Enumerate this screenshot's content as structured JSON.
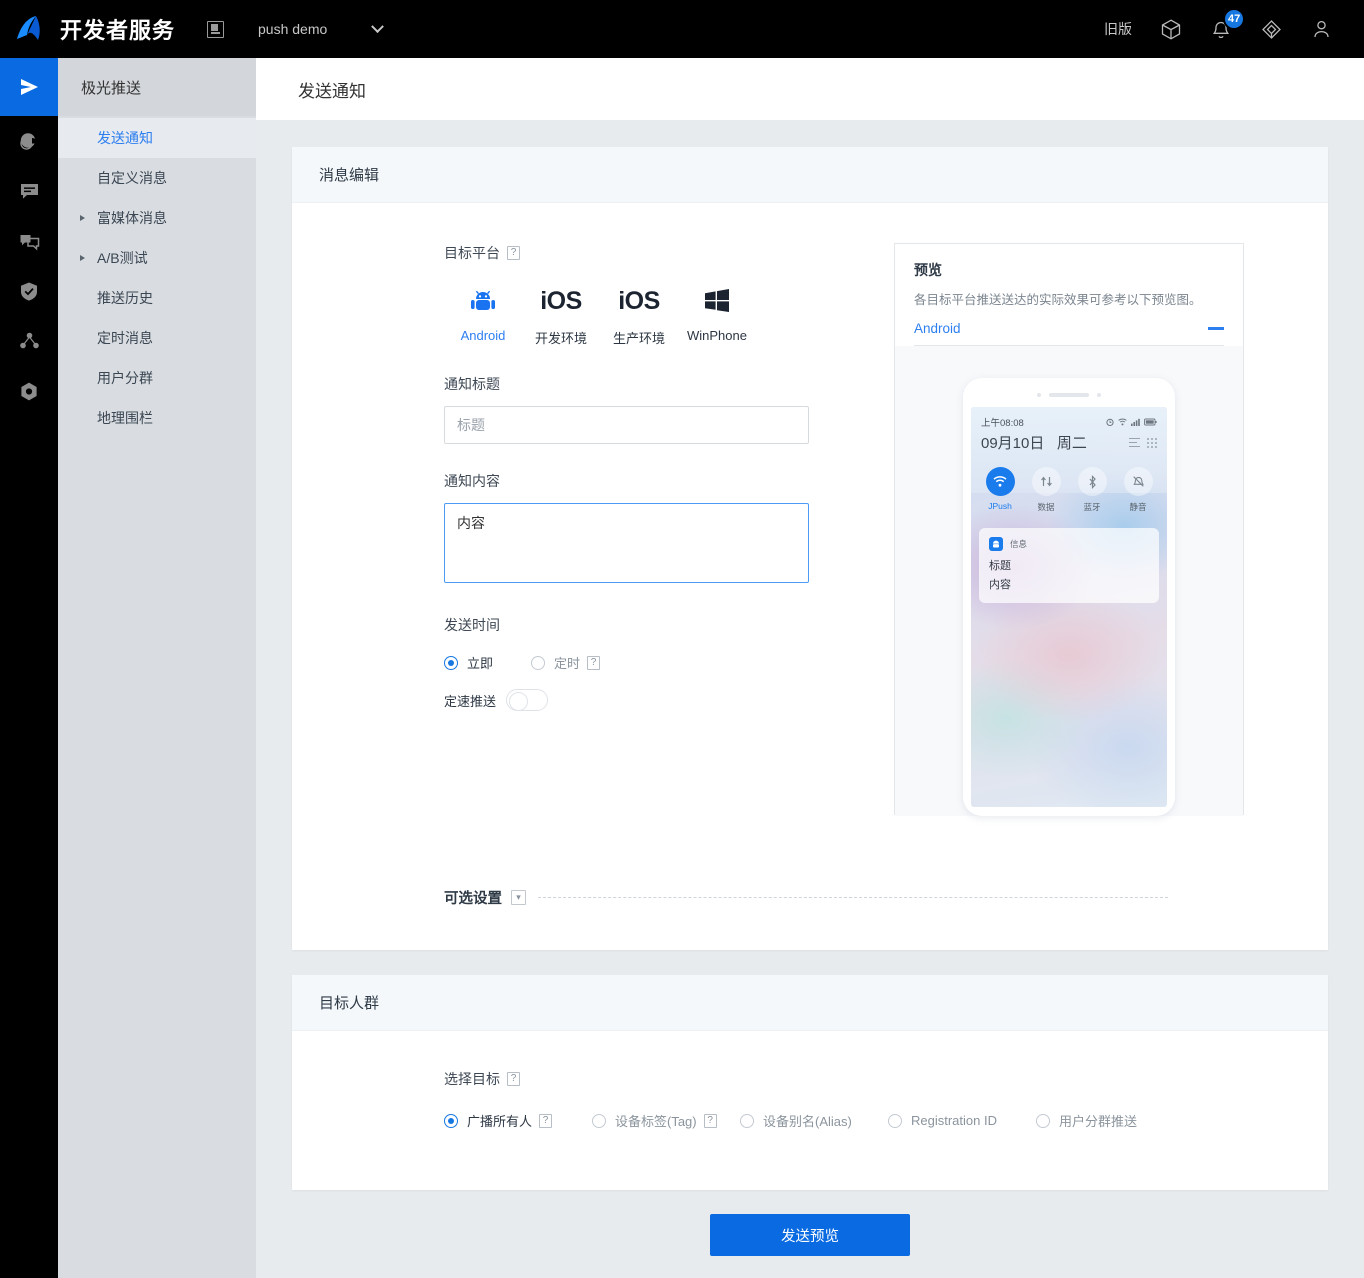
{
  "topbar": {
    "brand": "开发者服务",
    "project_icon": "window-icon",
    "project_name": "push demo",
    "caret": "chevron-down-icon",
    "legacy_label": "旧版",
    "cube_icon": "cube-icon",
    "bell_icon": "bell-icon",
    "bell_badge": "47",
    "help_icon": "lifebuoy-icon",
    "user_icon": "user-icon",
    "badge_color": "#1677e0"
  },
  "rail": {
    "items": [
      {
        "icon": "send-icon",
        "active": true
      },
      {
        "icon": "pie-chart-icon",
        "active": false
      },
      {
        "icon": "message-icon",
        "active": false
      },
      {
        "icon": "im-chat-icon",
        "active": false
      },
      {
        "icon": "shield-check-icon",
        "active": false
      },
      {
        "icon": "share-network-icon",
        "active": false
      },
      {
        "icon": "hexagon-settings-icon",
        "active": false
      }
    ]
  },
  "sidebar": {
    "title": "极光推送",
    "items": [
      {
        "label": "发送通知",
        "selected": true,
        "expandable": false
      },
      {
        "label": "自定义消息",
        "selected": false,
        "expandable": false
      },
      {
        "label": "富媒体消息",
        "selected": false,
        "expandable": true
      },
      {
        "label": "A/B测试",
        "selected": false,
        "expandable": true
      },
      {
        "label": "推送历史",
        "selected": false,
        "expandable": false
      },
      {
        "label": "定时消息",
        "selected": false,
        "expandable": false
      },
      {
        "label": "用户分群",
        "selected": false,
        "expandable": false
      },
      {
        "label": "地理围栏",
        "selected": false,
        "expandable": false
      }
    ]
  },
  "page": {
    "title": "发送通知"
  },
  "message_card": {
    "header": "消息编辑",
    "platform_label": "目标平台",
    "platform_help": "?",
    "platforms": [
      {
        "name": "Android",
        "icon": "android-icon",
        "active": true
      },
      {
        "name": "开发环境",
        "icon": "ios-icon",
        "active": false
      },
      {
        "name": "生产环境",
        "icon": "ios-icon",
        "active": false
      },
      {
        "name": "WinPhone",
        "icon": "windows-icon",
        "active": false
      }
    ],
    "title_label": "通知标题",
    "title_placeholder": "标题",
    "title_value": "",
    "content_label": "通知内容",
    "content_value": "内容",
    "content_placeholder": "内容",
    "send_time_label": "发送时间",
    "send_time_options": [
      {
        "label": "立即",
        "selected": true,
        "help": false
      },
      {
        "label": "定时",
        "selected": false,
        "help": true
      }
    ],
    "rate_label": "定速推送",
    "rate_on": false,
    "optional_label": "可选设置",
    "optional_chevron": "chevron-down-icon"
  },
  "preview": {
    "title": "预览",
    "subtitle": "各目标平台推送送达的实际效果可参考以下预览图。",
    "tab": "Android",
    "collapse_icon": "minus-icon",
    "phone": {
      "status_time": "上午08:08",
      "status_icons": [
        "alarm-icon",
        "wifi-icon",
        "signal-icon",
        "battery-icon"
      ],
      "date": "09月10日",
      "weekday": "周二",
      "date_icons": [
        "list-icon",
        "grid-icon"
      ],
      "toggles": [
        {
          "label": "JPush",
          "icon": "wifi-icon",
          "on": true
        },
        {
          "label": "数据",
          "icon": "data-icon",
          "on": false
        },
        {
          "label": "蓝牙",
          "icon": "bluetooth-icon",
          "on": false
        },
        {
          "label": "静音",
          "icon": "bell-mute-icon",
          "on": false
        }
      ],
      "notification": {
        "app_icon": "android-app-icon",
        "app_name": "信息",
        "title": "标题",
        "body": "内容"
      }
    }
  },
  "audience_card": {
    "header": "目标人群",
    "select_label": "选择目标",
    "select_help": "?",
    "options": [
      {
        "label": "广播所有人",
        "selected": true,
        "help": true
      },
      {
        "label": "设备标签(Tag)",
        "selected": false,
        "help": true
      },
      {
        "label": "设备别名(Alias)",
        "selected": false,
        "help": false
      },
      {
        "label": "Registration ID",
        "selected": false,
        "help": false
      },
      {
        "label": "用户分群推送",
        "selected": false,
        "help": false
      }
    ]
  },
  "footer": {
    "submit_label": "发送预览",
    "accent": "#0a6ae1"
  }
}
